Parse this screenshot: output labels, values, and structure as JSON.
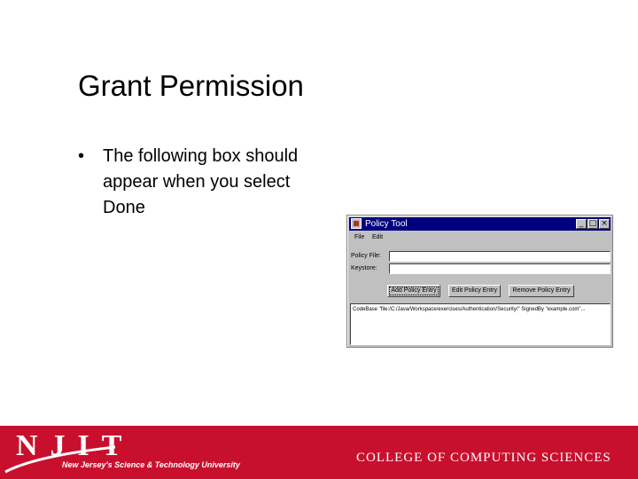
{
  "slide": {
    "title": "Grant Permission",
    "bullet_symbol": "•",
    "bullet_text": "The following box should appear when you select Done"
  },
  "window": {
    "title": "Policy Tool",
    "controls": {
      "minimize": "_",
      "maximize": "□",
      "close": "×"
    },
    "menu": [
      "File",
      "Edit"
    ],
    "fields": [
      {
        "label": "Policy File:",
        "value": ""
      },
      {
        "label": "Keystore:",
        "value": ""
      }
    ],
    "buttons": [
      "Add Policy Entry",
      "Edit Policy Entry",
      "Remove Policy Entry"
    ],
    "list_entries": [
      "CodeBase \"file:/C:/Java/Workspace/exercises/Authentication/Security/\" SignedBy \"example.com\"..."
    ]
  },
  "footer": {
    "logo_letters": "NJIT",
    "tagline": "New Jersey's Science & Technology University",
    "college": "COLLEGE OF COMPUTING SCIENCES",
    "color": "#c8102e"
  }
}
